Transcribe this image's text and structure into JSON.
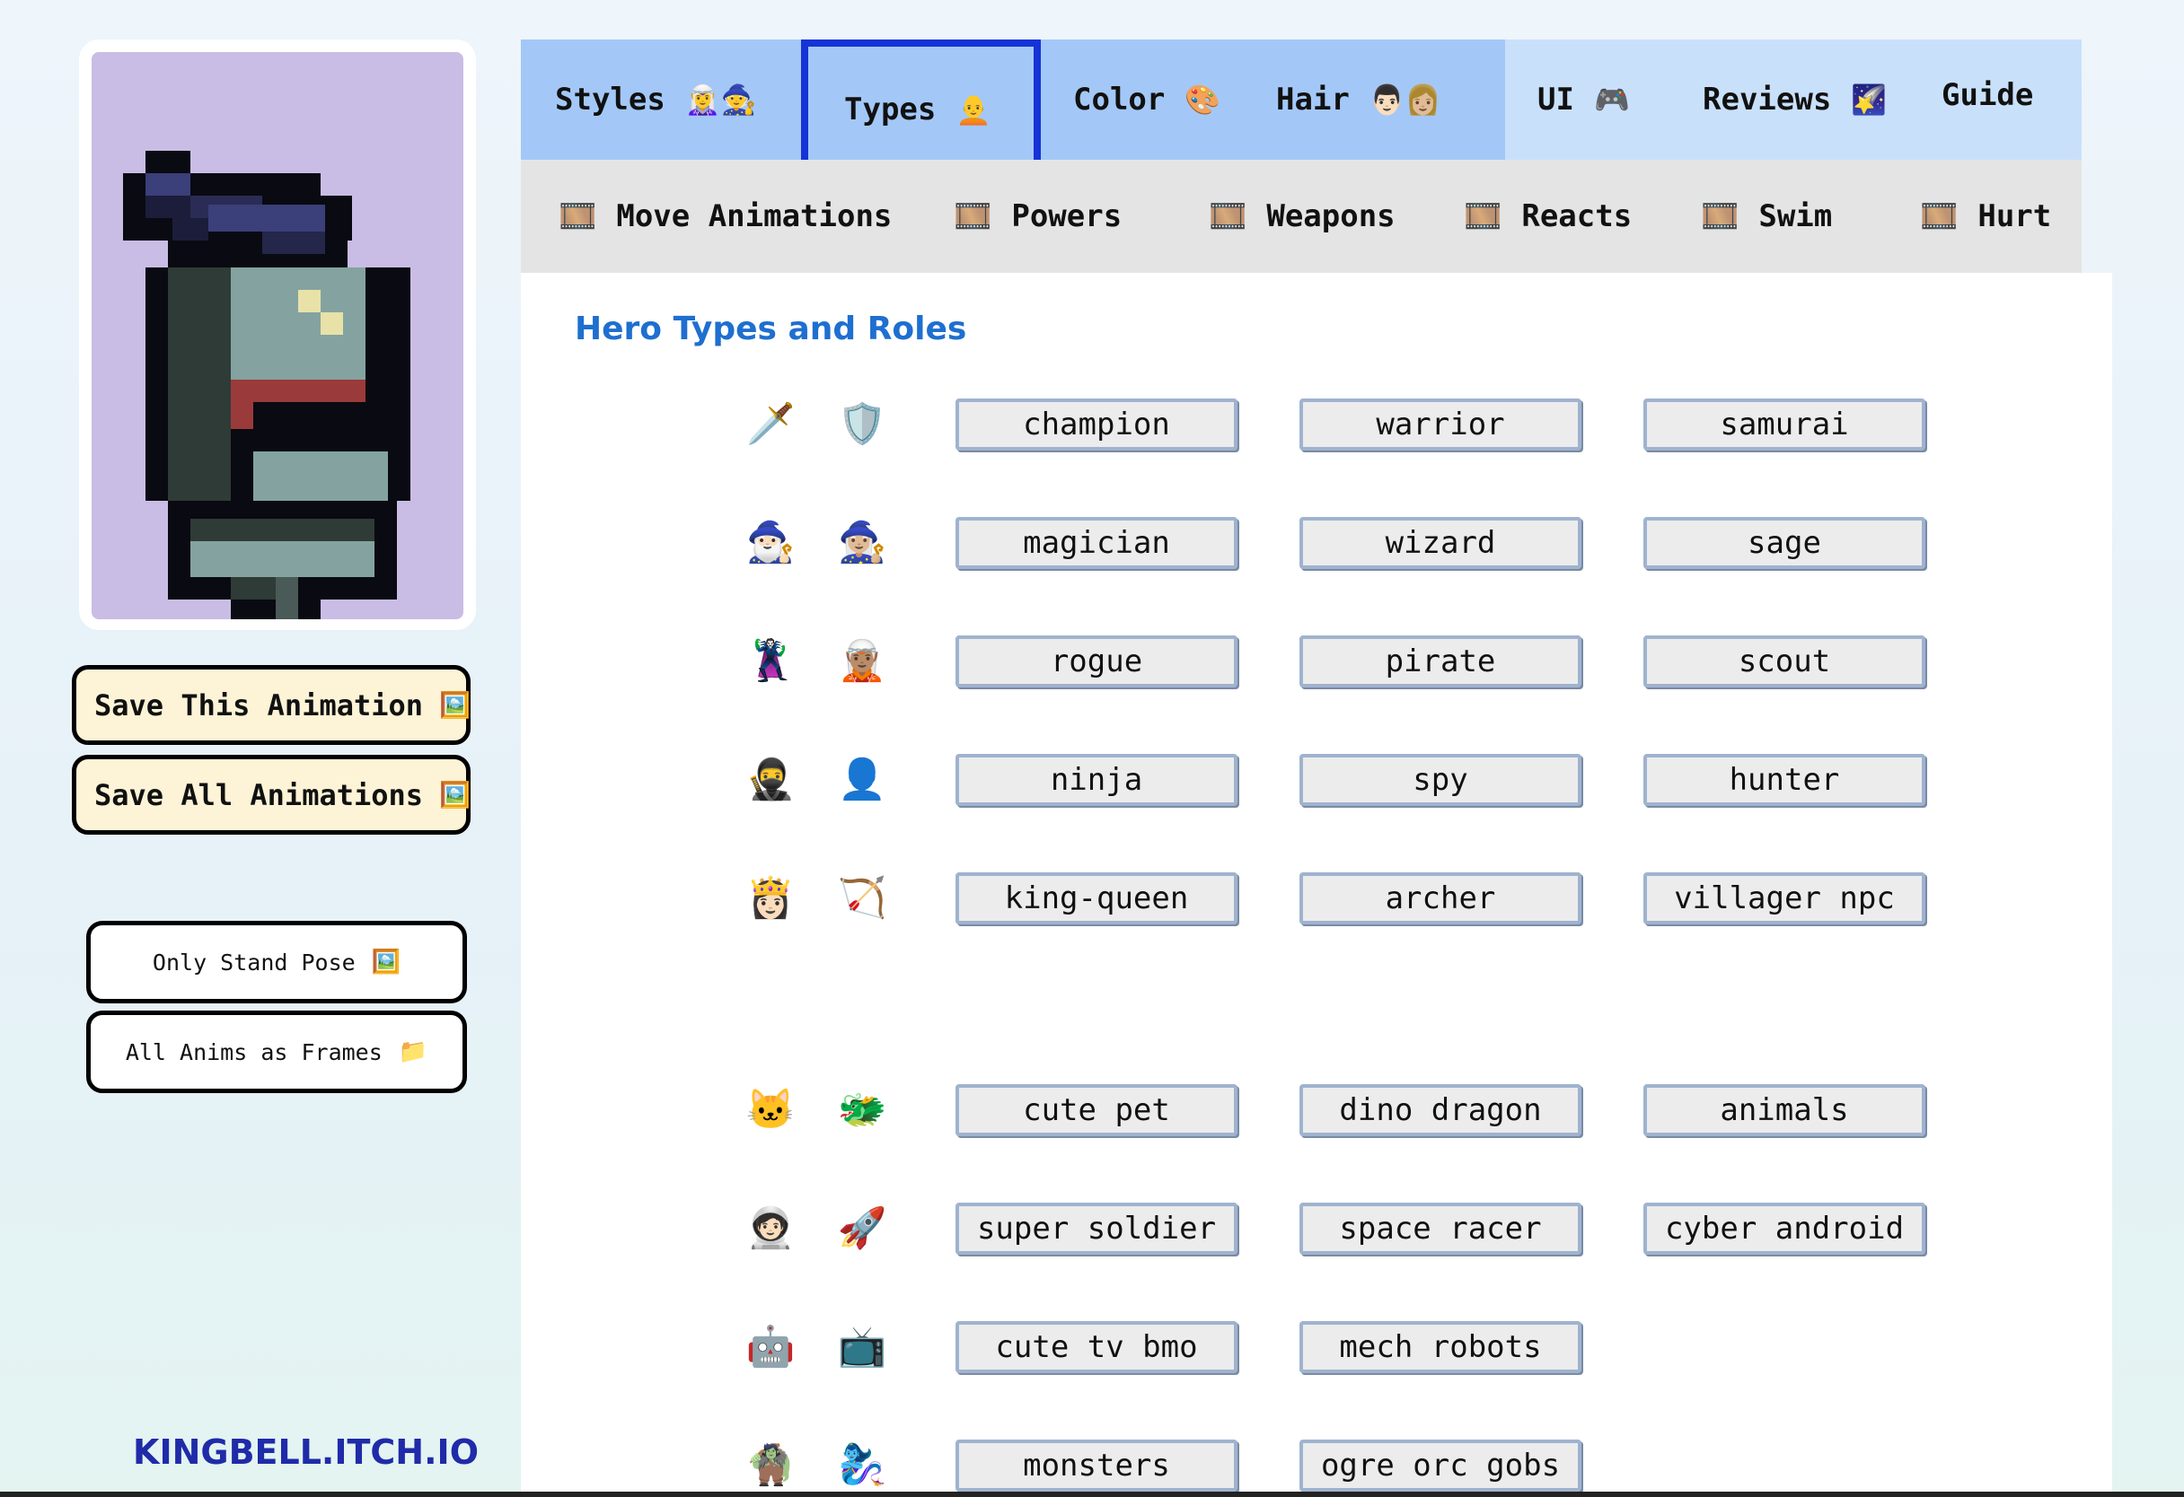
{
  "sidebar": {
    "save_this": {
      "label": "Save This Animation",
      "icon": "🖼️"
    },
    "save_all": {
      "label": "Save All Animations",
      "icon": "🖼️"
    },
    "only_stand": {
      "label": "Only Stand Pose",
      "icon": "🖼️"
    },
    "all_frames": {
      "label": "All Anims as Frames",
      "icon": "📁"
    },
    "site_link": "KINGBELL.ITCH.IO"
  },
  "tabs": [
    {
      "label": "Styles",
      "icon": "🧝‍♀️🧙"
    },
    {
      "label": "Types",
      "icon": "🧑‍🦲",
      "active": true
    },
    {
      "label": "Color",
      "icon": "🎨"
    },
    {
      "label": "Hair",
      "icon": "👨🏻👩🏼"
    },
    {
      "label": "UI",
      "icon": "🎮"
    },
    {
      "label": "Reviews",
      "icon": "🌠"
    },
    {
      "label": "Guide",
      "icon": ""
    }
  ],
  "subtabs": [
    {
      "label": "Move Animations",
      "icon": "🎞️"
    },
    {
      "label": "Powers",
      "icon": "🎞️"
    },
    {
      "label": "Weapons",
      "icon": "🎞️"
    },
    {
      "label": "Reacts",
      "icon": "🎞️"
    },
    {
      "label": "Swim",
      "icon": "🎞️"
    },
    {
      "label": "Hurt",
      "icon": "🎞️"
    }
  ],
  "main": {
    "title": "Hero Types and Roles",
    "rows": [
      {
        "emoji1": "🗡️",
        "emoji2": "🛡️",
        "buttons": [
          "champion",
          "warrior",
          "samurai"
        ]
      },
      {
        "emoji1": "🧙🏻‍♂️",
        "emoji2": "🧙🏼‍♀️",
        "buttons": [
          "magician",
          "wizard",
          "sage"
        ]
      },
      {
        "emoji1": "🦹",
        "emoji2": "🧝🏽",
        "buttons": [
          "rogue",
          "pirate",
          "scout"
        ]
      },
      {
        "emoji1": "🥷",
        "emoji2": "👤",
        "buttons": [
          "ninja",
          "spy",
          "hunter"
        ]
      },
      {
        "emoji1": "👸🏻",
        "emoji2": "🏹",
        "buttons": [
          "king-queen",
          "archer",
          "villager npc"
        ]
      },
      {
        "emoji1": "🐱",
        "emoji2": "🐲",
        "buttons": [
          "cute pet",
          "dino dragon",
          "animals"
        ]
      },
      {
        "emoji1": "🧑🏻‍🚀",
        "emoji2": "🚀",
        "buttons": [
          "super soldier",
          "space racer",
          "cyber android"
        ]
      },
      {
        "emoji1": "🤖",
        "emoji2": "📺",
        "buttons": [
          "cute tv bmo",
          "mech robots"
        ]
      },
      {
        "emoji1": "🧌",
        "emoji2": "🧞‍♀️",
        "buttons": [
          "monsters",
          "ogre orc gobs"
        ]
      }
    ]
  },
  "colors": {
    "tab_bar_light": "#a3c8f7",
    "tab_bar_lighter": "#c9e0fb",
    "active_tab_border": "#1533d6",
    "sprite_bg": "#c9bde5",
    "title_blue": "#1e6fd0",
    "save_button_bg": "#fdf3d6"
  }
}
